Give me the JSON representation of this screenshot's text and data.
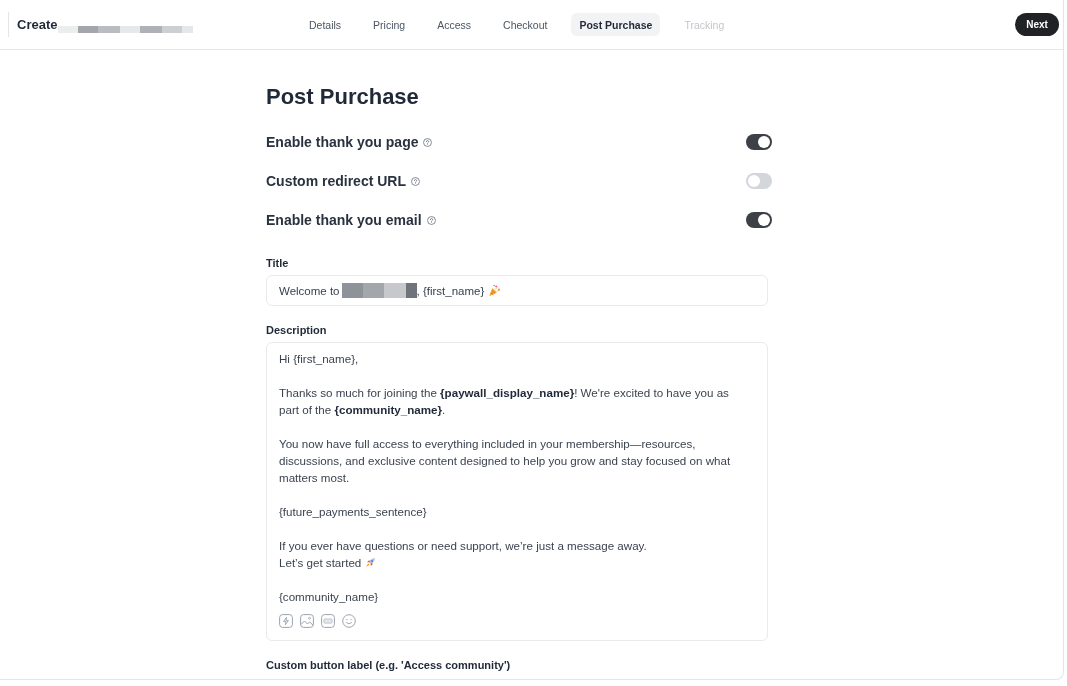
{
  "header": {
    "title": "Create",
    "tabs": [
      {
        "label": "Details",
        "selected": false,
        "disabled": false
      },
      {
        "label": "Pricing",
        "selected": false,
        "disabled": false
      },
      {
        "label": "Access",
        "selected": false,
        "disabled": false
      },
      {
        "label": "Checkout",
        "selected": false,
        "disabled": false
      },
      {
        "label": "Post Purchase",
        "selected": true,
        "disabled": false
      },
      {
        "label": "Tracking",
        "selected": false,
        "disabled": true
      }
    ],
    "next_button": "Next"
  },
  "page": {
    "heading": "Post Purchase",
    "toggles": [
      {
        "label": "Enable thank you page",
        "on": true
      },
      {
        "label": "Custom redirect URL",
        "on": false
      },
      {
        "label": "Enable thank you email",
        "on": true
      }
    ],
    "title_field": {
      "label": "Title",
      "value_start": "Welcome to",
      "value_end": ", {first_name}"
    },
    "description": {
      "label": "Description",
      "blocks": [
        {
          "paragraphs": [
            {
              "kind": "text",
              "lines": [
                "Hi {first_name},"
              ]
            }
          ]
        },
        {
          "paragraphs": [
            {
              "kind": "text",
              "lines": [
                "Thanks so much for joining the **{paywall_display_name}**! We're excited to have you as",
                "part of the **{community_name}**."
              ]
            }
          ]
        },
        {
          "paragraphs": [
            {
              "kind": "text",
              "lines": [
                "You now have full access to everything included in your membership—resources,",
                "discussions, and exclusive content designed to help you grow and stay focused on what",
                "matters most."
              ]
            }
          ]
        },
        {
          "paragraphs": [
            {
              "kind": "text",
              "lines": [
                "{future_payments_sentence}"
              ]
            }
          ]
        },
        {
          "paragraphs": [
            {
              "kind": "text",
              "lines": [
                "If you ever have questions or need support, we’re just a message away."
              ]
            },
            {
              "kind": "emoji",
              "lines": [
                "Let’s get started"
              ]
            }
          ]
        },
        {
          "paragraphs": [
            {
              "kind": "text",
              "lines": [
                "{community_name}"
              ]
            }
          ]
        }
      ]
    },
    "button_label_field": {
      "label": "Custom button label (e.g. 'Access community')"
    }
  }
}
